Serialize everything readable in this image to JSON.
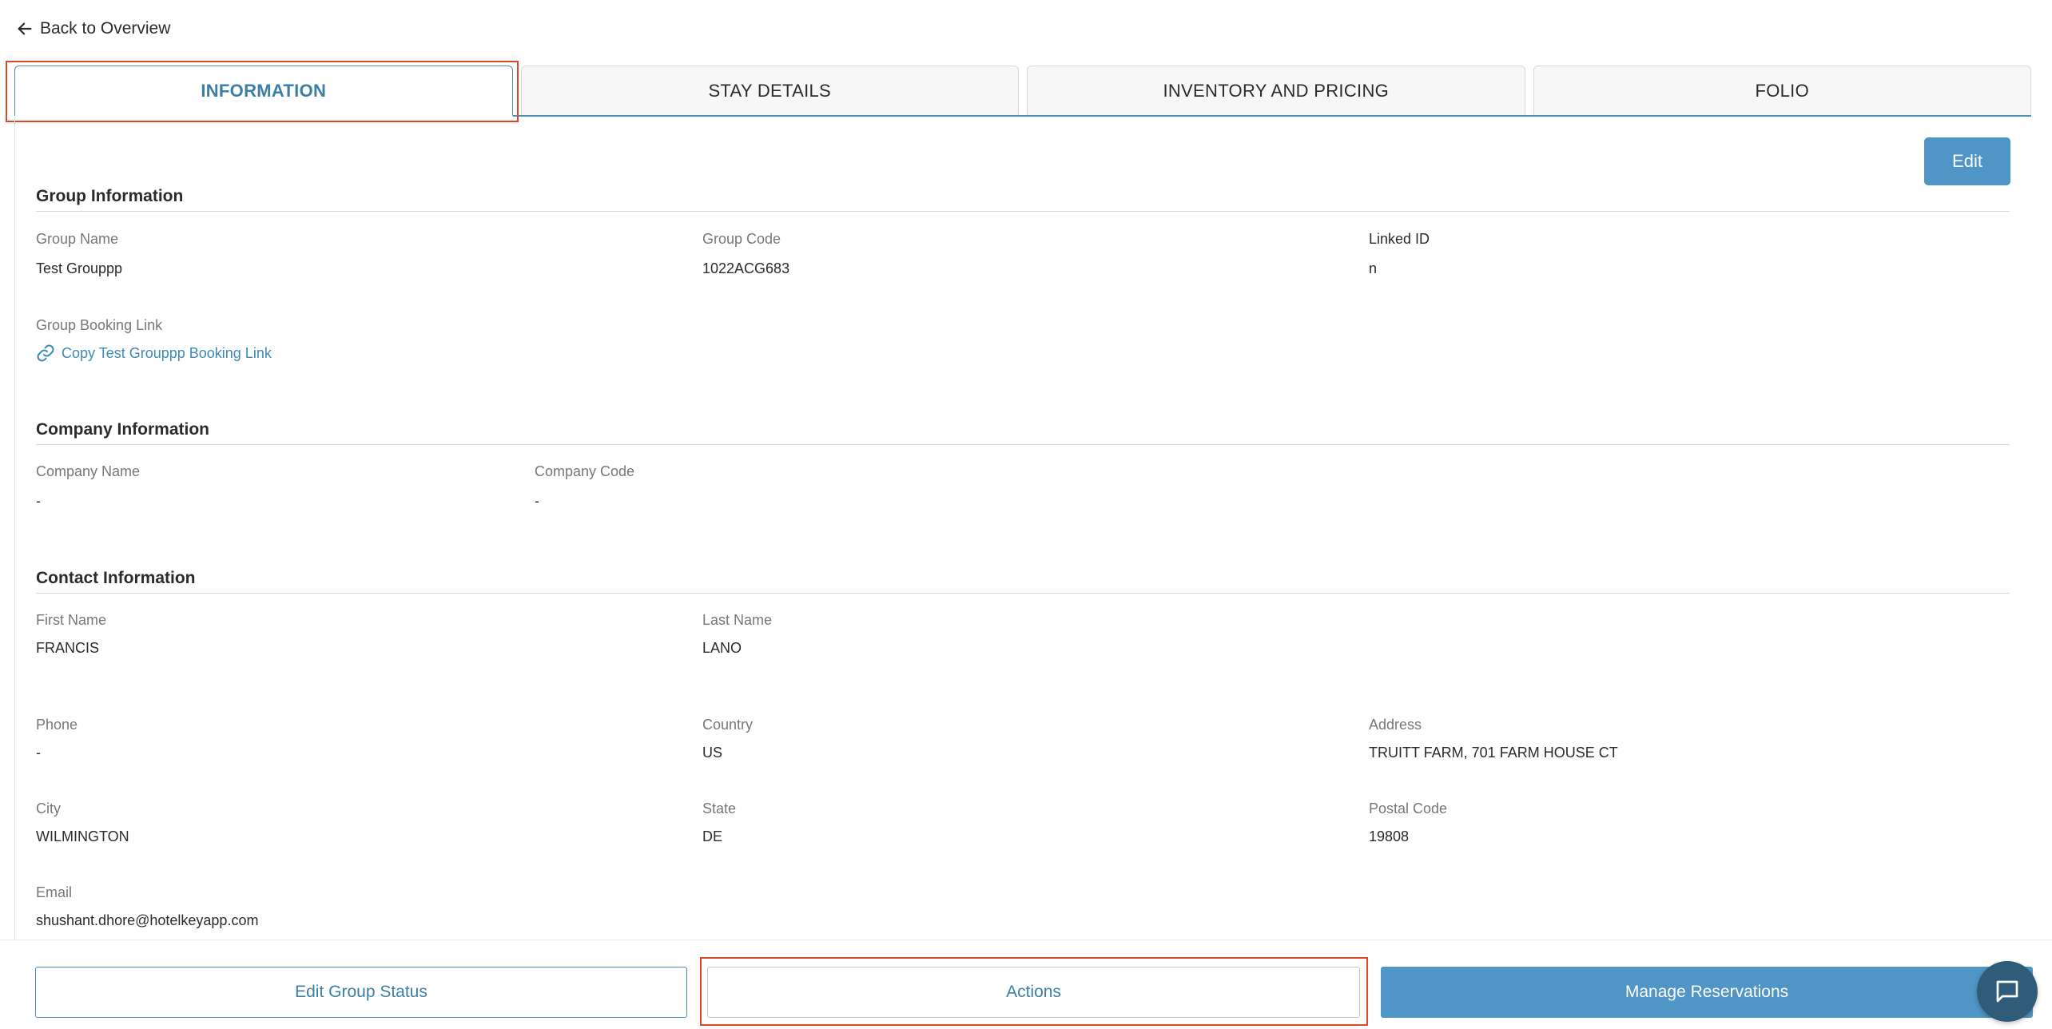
{
  "nav": {
    "back_label": "Back to Overview"
  },
  "tabs": [
    {
      "label": "INFORMATION",
      "active": true
    },
    {
      "label": "STAY DETAILS",
      "active": false
    },
    {
      "label": "INVENTORY AND PRICING",
      "active": false
    },
    {
      "label": "FOLIO",
      "active": false
    }
  ],
  "toolbar": {
    "edit_label": "Edit"
  },
  "group": {
    "title": "Group Information",
    "name_label": "Group Name",
    "name_value": "Test Grouppp",
    "code_label": "Group Code",
    "code_value": "1022ACG683",
    "linked_label": "Linked ID",
    "linked_value": "n",
    "booking_link_label": "Group Booking Link",
    "booking_link_text": "Copy Test Grouppp Booking Link"
  },
  "company": {
    "title": "Company Information",
    "name_label": "Company Name",
    "name_value": "-",
    "code_label": "Company Code",
    "code_value": "-"
  },
  "contact": {
    "title": "Contact Information",
    "first_name_label": "First Name",
    "first_name_value": "FRANCIS",
    "last_name_label": "Last Name",
    "last_name_value": "LANO",
    "phone_label": "Phone",
    "phone_value": "-",
    "country_label": "Country",
    "country_value": "US",
    "address_label": "Address",
    "address_value": "TRUITT FARM, 701 FARM HOUSE CT",
    "city_label": "City",
    "city_value": "WILMINGTON",
    "state_label": "State",
    "state_value": "DE",
    "postal_label": "Postal Code",
    "postal_value": "19808",
    "email_label": "Email",
    "email_value": "shushant.dhore@hotelkeyapp.com"
  },
  "footer": {
    "edit_status_label": "Edit Group Status",
    "actions_label": "Actions",
    "manage_label": "Manage Reservations"
  },
  "colors": {
    "accent": "#4f95c6",
    "accent_text": "#3d7ea6",
    "highlight": "#e0472a",
    "chat": "#2f5d79"
  },
  "icons": {
    "back": "arrow-left-icon",
    "link": "link-icon",
    "chat": "chat-icon"
  }
}
